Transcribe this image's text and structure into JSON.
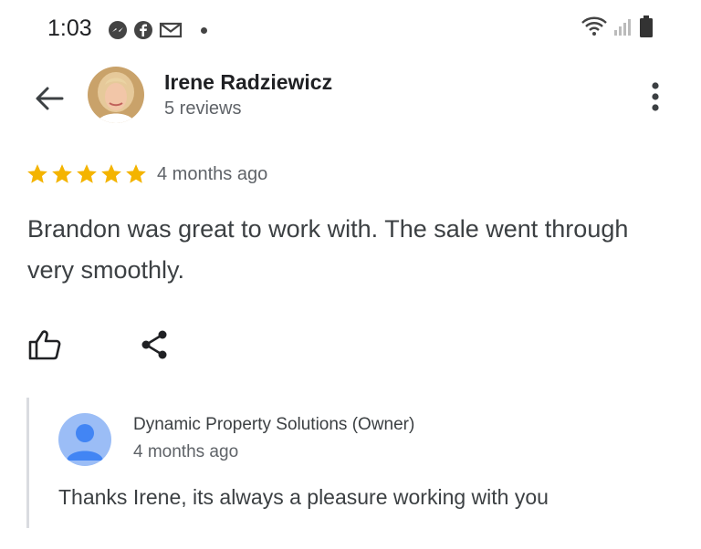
{
  "status_bar": {
    "time": "1:03",
    "app_icons": [
      "messenger-icon",
      "facebook-icon",
      "gmail-icon"
    ],
    "system_icons": [
      "wifi-icon",
      "signal-icon",
      "battery-icon"
    ]
  },
  "header": {
    "reviewer_name": "Irene Radziewicz",
    "reviewer_reviews": "5 reviews"
  },
  "review": {
    "rating": 5,
    "rating_max": 5,
    "age": "4 months ago",
    "text": "Brandon was great to work with. The sale went through very smoothly."
  },
  "owner_reply": {
    "name": "Dynamic Property Solutions (Owner)",
    "age": "4 months ago",
    "text": "Thanks Irene, its always a pleasure working with you"
  },
  "colors": {
    "star": "#f4b400",
    "primary_text": "#202124",
    "secondary_text": "#5f6368",
    "body_text": "#3c4043",
    "owner_avatar_bg": "#9bbdf6",
    "owner_avatar_fg": "#4285f4"
  }
}
